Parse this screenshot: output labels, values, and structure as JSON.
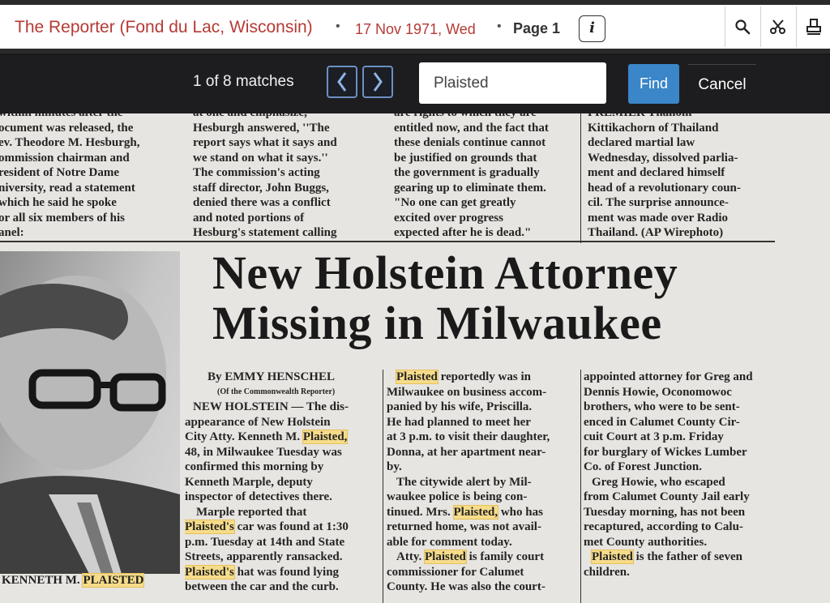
{
  "header": {
    "publication": "The Reporter (Fond du Lac, Wisconsin)",
    "separator": "•",
    "date": "17 Nov 1971, Wed",
    "page": "Page 1",
    "info_glyph": "i",
    "tools": [
      "search-icon",
      "clip-icon",
      "print-icon"
    ]
  },
  "findbar": {
    "match_text": "1 of 8 matches",
    "query": "Plaisted",
    "find_label": "Find",
    "cancel_label": "Cancel"
  },
  "article": {
    "top_col1": [
      "within minutes after the",
      "ocument was released, the",
      "ev. Theodore M. Hesburgh,",
      "ommission chairman and",
      "resident of Notre Dame",
      "niversity, read a statement",
      "which he said he spoke",
      "or all six members of his",
      "anel:"
    ],
    "top_col2": [
      "at one and emphasize,",
      "Hesburgh answered, ''The",
      "report says what it says and",
      "we stand on what it says.''",
      "The commission's acting",
      "staff director, John Buggs,",
      "denied there was a conflict",
      "and noted portions of",
      "Hesburg's statement calling"
    ],
    "top_col3": [
      "are rights to which they are",
      "entitled now, and the fact that",
      "these denials continue cannot",
      "be justified on grounds that",
      "the government is gradually",
      "gearing up to eliminate them.",
      "\"No one can get greatly",
      "excited over progress",
      "expected after he is dead.\""
    ],
    "top_col4": [
      "PREMIER Thanom",
      "Kittikachorn of Thailand",
      "declared martial law",
      "Wednesday, dissolved parlia-",
      "ment and declared himself",
      "head of a revolutionary coun-",
      "cil. The surprise announce-",
      "ment was made over Radio",
      "Thailand.      (AP Wirephoto)"
    ],
    "headline_line1": "New Holstein Attorney",
    "headline_line2": "Missing in Milwaukee",
    "byline": "By EMMY HENSCHEL",
    "byline_source": "(Of the Commonwealth Reporter)",
    "body_col1": [
      "NEW HOLSTEIN — The dis-",
      "appearance of New Holstein",
      "City Atty. Kenneth M.",
      "48, in Milwaukee Tuesday was",
      "confirmed this morning by",
      "Kenneth Marple, deputy",
      "inspector of detectives there.",
      "Marple reported that",
      "car was found at 1:30",
      "p.m. Tuesday at 14th and State",
      "Streets, apparently ransacked.",
      "hat was found lying",
      "between the car and the curb."
    ],
    "body_col2": [
      "reportedly was in",
      "Milwaukee on business accom-",
      "panied by his wife, Priscilla.",
      "He had planned to meet her",
      "at 3 p.m. to visit their daughter,",
      "Donna, at her apartment near-",
      "by.",
      "The citywide alert by Mil-",
      "waukee police is being con-",
      "tinued. Mrs.",
      "returned home, was not avail-",
      "able for comment today.",
      "Atty.",
      "commissioner for Calumet",
      "County. He was also the court-"
    ],
    "body_col3": [
      "appointed attorney for Greg and",
      "Dennis Howie, Oconomowoc",
      "brothers, who were to be sent-",
      "enced in Calumet County Cir-",
      "cuit Court at 3 p.m. Friday",
      "for burglary of Wickes Lumber",
      "Co. of Forest Junction.",
      "Greg Howie, who escaped",
      "from Calumet County Jail early",
      "Tuesday morning, has not been",
      "recaptured, according to Calu-",
      "met County authorities.",
      "is the father of seven",
      "children."
    ],
    "hl_plaisted": "Plaisted",
    "hl_plaisted_comma": "Plaisted,",
    "hl_plaisteds": "Plaisted's",
    "col2_line10_tail": "who has",
    "col2_line13_tail": "is family court",
    "caption_name": "KENNETH M.",
    "caption_hl": "PLAISTED"
  },
  "colors": {
    "title_red": "#b53a35",
    "find_blue": "#3a86c8",
    "highlight": "#f6dc8a"
  }
}
